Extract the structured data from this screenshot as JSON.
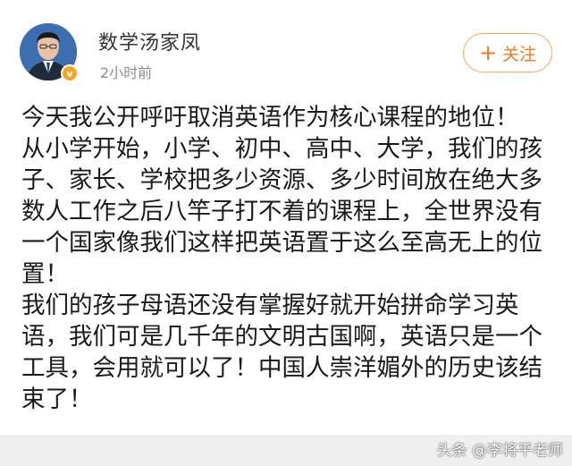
{
  "post": {
    "username": "数学汤家凤",
    "timestamp": "2小时前",
    "follow_label": "关注",
    "follow_icon": "plus-icon",
    "verified_badge": "v",
    "paragraphs": [
      "今天我公开呼吁取消英语作为核心课程的地位！",
      "从小学开始，小学、初中、高中、大学，我们的孩子、家长、学校把多少资源、多少时间放在绝大多数人工作之后八竿子打不着的课程上，全世界没有一个国家像我们这样把英语置于这么至高无上的位置！",
      "我们的孩子母语还没有掌握好就开始拼命学习英语，我们可是几千年的文明古国啊，英语只是一个工具，会用就可以了！中国人崇洋媚外的历史该结束了！"
    ]
  },
  "watermark": "头条 @李将平老师",
  "colors": {
    "accent": "#f07b24",
    "verified": "#f6a623"
  }
}
